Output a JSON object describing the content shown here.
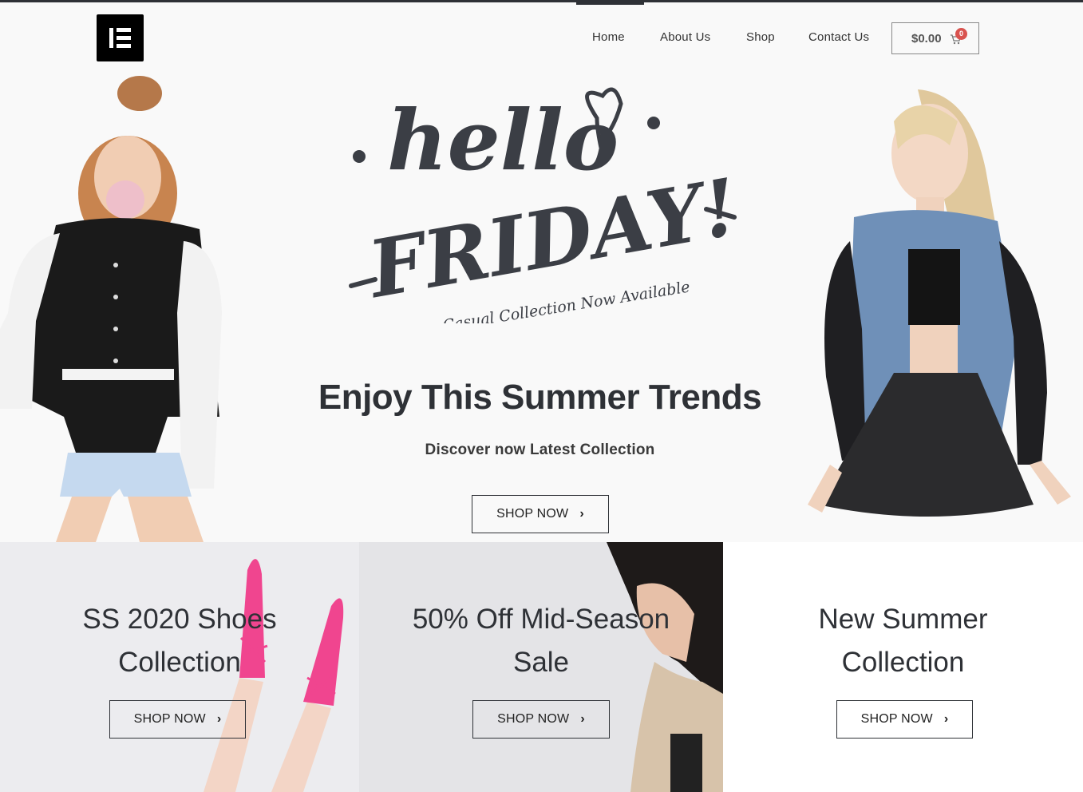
{
  "header": {
    "logo_icon": "elementor-logo",
    "nav": [
      "Home",
      "About Us",
      "Shop",
      "Contact Us"
    ],
    "active_nav": "Home",
    "cart": {
      "amount": "$0.00",
      "count": "0",
      "icon": "cart-icon"
    }
  },
  "hero": {
    "script_hello": "hello",
    "script_friday": "FRIDAY!",
    "script_tagline": "Casual Collection Now Available",
    "title": "Enjoy This Summer Trends",
    "subtitle": "Discover now Latest Collection",
    "button": "SHOP NOW"
  },
  "tiles": [
    {
      "title_line1": "SS 2020 Shoes",
      "title_line2": "Collection",
      "button": "SHOP NOW"
    },
    {
      "title_line1": "50% Off Mid-Season",
      "title_line2": "Sale",
      "button": "SHOP NOW"
    },
    {
      "title_line1": "New Summer",
      "title_line2": "Collection",
      "button": "SHOP NOW"
    }
  ],
  "colors": {
    "dark": "#2e3136",
    "background": "#f9f9f9",
    "badge": "#d9534f",
    "tile1_bg": "#ececef",
    "tile2_bg": "#e4e4e7",
    "tile3_bg": "#ffffff",
    "shoe_pink": "#f0458f"
  }
}
